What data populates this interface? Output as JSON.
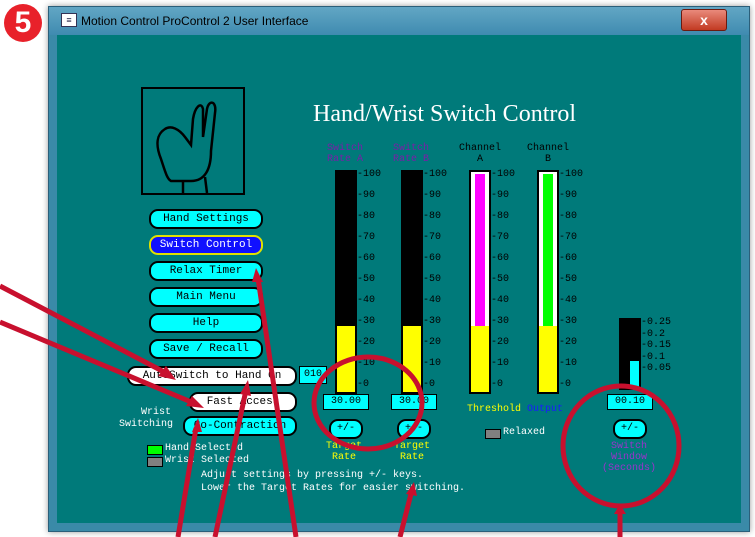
{
  "step_number": "5",
  "window": {
    "title": "Motion Control ProControl 2 User Interface",
    "close_glyph": "x"
  },
  "heading": "Hand/Wrist Switch Control",
  "menu": {
    "hand_settings": "Hand Settings",
    "switch_control": "Switch Control",
    "relax_timer": "Relax Timer",
    "main_menu": "Main Menu",
    "help": "Help",
    "save_recall": "Save / Recall",
    "autoswitch": "AutoSwitch to Hand On",
    "autoswitch_value": "010",
    "fast_access": "Fast Access",
    "co_contraction": "Co-Contraction",
    "switching_label_1": "Wrist",
    "switching_label_2": "Switching"
  },
  "legend": {
    "hand": "Hand Selected",
    "wrist": "Wrist Selected",
    "relaxed": "Relaxed",
    "hand_color": "#00ff00",
    "wrist_color": "#808080"
  },
  "gauges": {
    "rate_a": {
      "label1": "Switch",
      "label2": "Rate A",
      "value": "30.00",
      "level": 0.3,
      "pm": "+/-",
      "cap1": "Target",
      "cap2": "Rate"
    },
    "rate_b": {
      "label1": "Switch",
      "label2": "Rate B",
      "value": "30.00",
      "level": 0.3,
      "pm": "+/-",
      "cap1": "Target",
      "cap2": "Rate"
    },
    "chan_a": {
      "label1": "Channel",
      "label2": "A",
      "threshold": 0.3,
      "output": 1.0
    },
    "chan_b": {
      "label1": "Channel",
      "label2": "B",
      "threshold": 0.3,
      "output": 1.0
    },
    "window": {
      "value": "00.10",
      "level": 0.1,
      "pm": "+/-",
      "cap1": "Switch",
      "cap2": "Window",
      "cap3": "(Seconds)"
    }
  },
  "scale_100": [
    "100",
    "90",
    "80",
    "70",
    "60",
    "50",
    "40",
    "30",
    "20",
    "10",
    "0"
  ],
  "scale_small": [
    "0.25",
    "0.2",
    "0.15",
    "0.1",
    "0.05"
  ],
  "threshold_label": "Threshold",
  "output_label": "Output",
  "instructions": {
    "line1": "Adjust settings by pressing +/- keys.",
    "line2": "Lower the Target Rates for easier switching."
  },
  "colors": {
    "teal": "#007a7a",
    "yellow": "#ffff00",
    "magenta": "#ff00ff",
    "green": "#00ff00",
    "cyan": "#00ffff",
    "annotation": "#c8102e"
  }
}
